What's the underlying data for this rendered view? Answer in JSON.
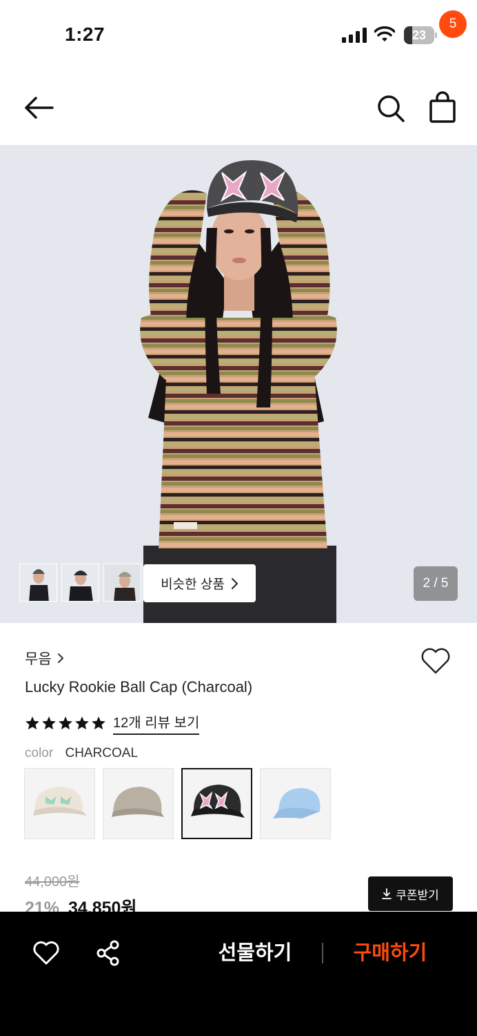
{
  "status_bar": {
    "time": "1:27",
    "battery": "23"
  },
  "header": {
    "cart_count": "5",
    "icons": [
      "arrow-left-icon",
      "search-icon",
      "shopping-bag-icon"
    ]
  },
  "gallery": {
    "similar_label": "비슷한 상품",
    "page_indicator": "2 / 5"
  },
  "product": {
    "brand": "무음",
    "name": "Lucky Rookie Ball Cap (Charcoal)",
    "rating": 5,
    "review_link": "12개 리뷰 보기",
    "color_label": "color",
    "color_value": "CHARCOAL",
    "swatches": [
      {
        "color": "#ece4d8",
        "accent": "#9ad8b8"
      },
      {
        "color": "#b8b0a2",
        "accent": "#a29a8c"
      },
      {
        "color": "#2b2b2b",
        "accent": "#e9a6c6"
      },
      {
        "color": "#a9cdee",
        "accent": "#ffffff"
      }
    ],
    "selected_swatch": 2
  },
  "pricing": {
    "original_price": "44,000원",
    "discount": "21%",
    "sale_price": "34,850원",
    "coupon_label": "쿠폰받기"
  },
  "bottom_bar": {
    "gift_label": "선물하기",
    "buy_label": "구매하기"
  },
  "colors": {
    "accent": "#ff4b0d",
    "bottom_bar_bg": "#000000"
  }
}
